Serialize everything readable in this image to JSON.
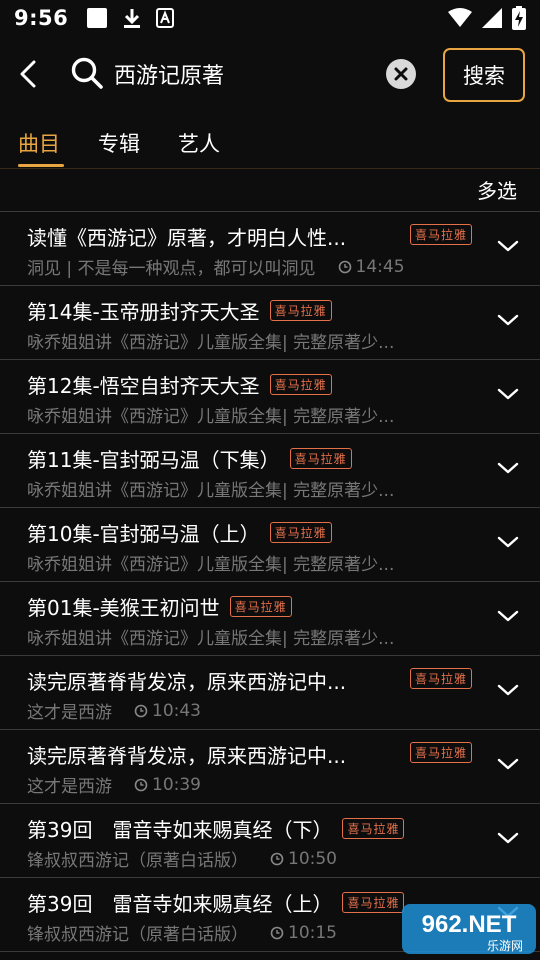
{
  "status": {
    "time": "9:56"
  },
  "search": {
    "back_label": "back",
    "query": "西游记原著",
    "button_label": "搜索"
  },
  "tabs": [
    {
      "label": "曲目",
      "active": true
    },
    {
      "label": "专辑",
      "active": false
    },
    {
      "label": "艺人",
      "active": false
    }
  ],
  "multiselect_label": "多选",
  "colors": {
    "accent": "#e8a642",
    "badge": "#e4704a",
    "subtext": "#777777"
  },
  "results": [
    {
      "title": "读懂《西游记》原著，才明白人性...",
      "badge": "喜马拉雅",
      "subtitle": "洞见 | 不是每一种观点，都可以叫洞见",
      "duration": "14:45"
    },
    {
      "title": "第14集-玉帝册封齐天大圣",
      "badge": "喜马拉雅",
      "subtitle": "咏乔姐姐讲《西游记》儿童版全集| 完整原著少...",
      "duration": ""
    },
    {
      "title": "第12集-悟空自封齐天大圣",
      "badge": "喜马拉雅",
      "subtitle": "咏乔姐姐讲《西游记》儿童版全集| 完整原著少...",
      "duration": ""
    },
    {
      "title": "第11集-官封弼马温（下集）",
      "badge": "喜马拉雅",
      "subtitle": "咏乔姐姐讲《西游记》儿童版全集| 完整原著少...",
      "duration": ""
    },
    {
      "title": "第10集-官封弼马温（上）",
      "badge": "喜马拉雅",
      "subtitle": "咏乔姐姐讲《西游记》儿童版全集| 完整原著少...",
      "duration": ""
    },
    {
      "title": "第01集-美猴王初问世",
      "badge": "喜马拉雅",
      "subtitle": "咏乔姐姐讲《西游记》儿童版全集| 完整原著少...",
      "duration": ""
    },
    {
      "title": "读完原著脊背发凉，原来西游记中...",
      "badge": "喜马拉雅",
      "subtitle": "这才是西游",
      "duration": "10:43"
    },
    {
      "title": "读完原著脊背发凉，原来西游记中...",
      "badge": "喜马拉雅",
      "subtitle": "这才是西游",
      "duration": "10:39"
    },
    {
      "title": "第39回　雷音寺如来赐真经（下）",
      "badge": "喜马拉雅",
      "subtitle": "锋叔叔西游记（原著白话版）",
      "duration": "10:50"
    },
    {
      "title": "第39回　雷音寺如来赐真经（上）",
      "badge": "喜马拉雅",
      "subtitle": "锋叔叔西游记（原著白话版）",
      "duration": "10:15"
    }
  ],
  "watermark": {
    "text": "962.NET",
    "subtext": "乐游网"
  }
}
